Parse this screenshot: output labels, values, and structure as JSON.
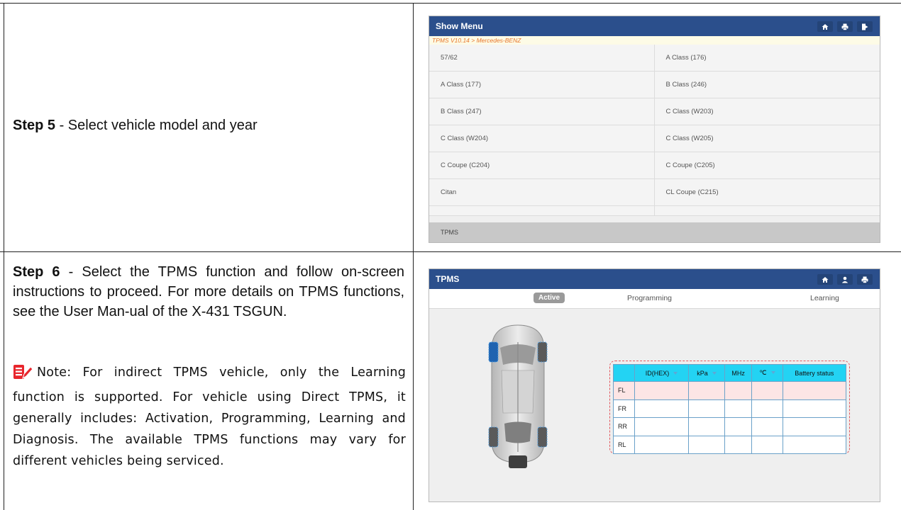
{
  "step5": {
    "label": "Step 5",
    "text": " -  Select vehicle model and year"
  },
  "step6": {
    "label": "Step 6",
    "text": " - Select the TPMS function and follow on-screen instructions to proceed. For more details on TPMS functions, see the User Man-ual of the X-431 TSGUN."
  },
  "note": {
    "text": "Note: For indirect TPMS vehicle, only the Learning function is supported. For vehicle using Direct TPMS, it generally includes: Activation, Programming, Learning and Diagnosis. The available TPMS functions may vary for different vehicles being serviced.",
    "icon": "note-edit-icon",
    "icon_color": "#e8262d"
  },
  "screen1": {
    "title": "Show Menu",
    "breadcrumb": "TPMS V10.14 > Mercedes-BENZ",
    "header_color": "#2b4f8c",
    "breadcrumb_color": "#e8762d",
    "icons": [
      "home-icon",
      "print-icon",
      "exit-icon"
    ],
    "items": [
      "57/62",
      "A Class (176)",
      "A Class (177)",
      "B Class (246)",
      "B Class (247)",
      "C Class (W203)",
      "C Class (W204)",
      "C Class (W205)",
      "C Coupe (C204)",
      "C Coupe (C205)",
      "Citan",
      "CL Coupe (C215)"
    ],
    "status": "TPMS"
  },
  "screen2": {
    "title": "TPMS",
    "icons": [
      "home-icon",
      "user-icon",
      "print-icon"
    ],
    "tabs": [
      "Active",
      "Programming",
      "Learning"
    ],
    "columns": [
      "ID(HEX)",
      "kPa",
      "MHz",
      "℃",
      "Battery status"
    ],
    "rows": [
      "FL",
      "FR",
      "RR",
      "RL"
    ],
    "header_color": "#23d3f3",
    "highlight_color": "#fde5e5"
  }
}
